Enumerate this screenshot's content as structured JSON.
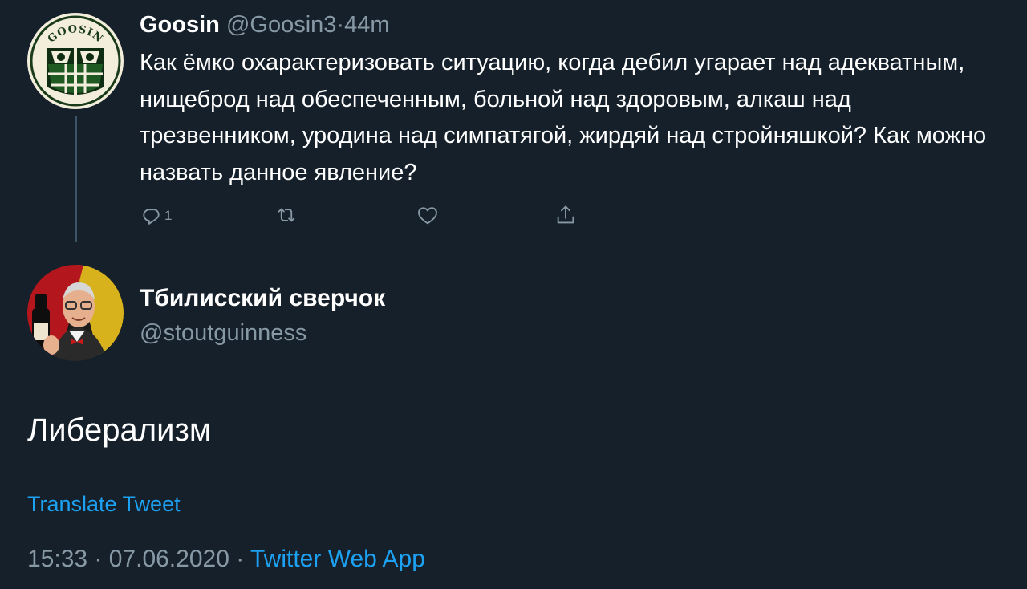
{
  "parent_tweet": {
    "display_name": "Goosin",
    "handle": "@Goosin3",
    "separator": "·",
    "time": "44m",
    "avatar_text": "GOOSIN",
    "text": "Как ёмко охарактеризовать ситуацию, когда дебил угарает над адекватным, нищеброд над обеспеченным, больной над здоровым, алкаш над трезвенником, уродина над симпатягой, жирдяй над стройняшкой? Как можно назвать данное явление?",
    "actions": {
      "reply_count": "1",
      "retweet_count": "",
      "like_count": ""
    }
  },
  "reply_tweet": {
    "display_name": "Тбилисский сверчок",
    "handle": "@stoutguinness",
    "text": "Либерализм",
    "translate_label": "Translate Tweet",
    "timestamp": "15:33 · 07.06.2020 ·",
    "source": "Twitter Web App"
  },
  "colors": {
    "background": "#15202b",
    "primary_text": "#ffffff",
    "secondary_text": "#8899a6",
    "accent": "#1da1f2",
    "thread_line": "#3d5466"
  },
  "icons": [
    "reply-icon",
    "retweet-icon",
    "like-icon",
    "share-icon"
  ]
}
